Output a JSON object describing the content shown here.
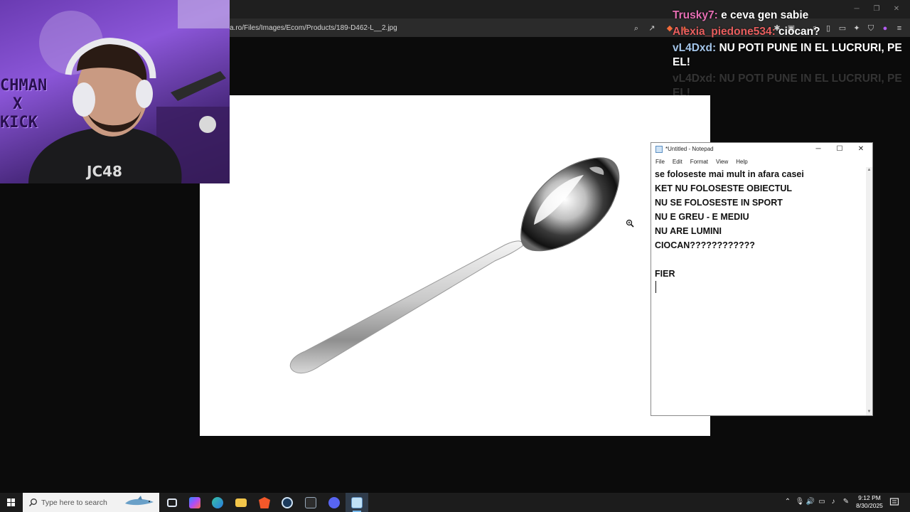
{
  "browser": {
    "url": "a.ro/Files/Images/Ecom/Products/189-D462-L__2.jpg",
    "toolbar_icons": [
      "zoom-icon",
      "share-icon",
      "brave-shield-icon",
      "brave-rewards-icon",
      "extensions-icon",
      "screenshot-icon",
      "music-icon",
      "sidebar-icon",
      "wallet-icon",
      "leo-icon",
      "vpn-icon",
      "menu-icon"
    ]
  },
  "viewer": {
    "image_subject": "spoon"
  },
  "chat": {
    "messages": [
      {
        "user": "Trusky7:",
        "text": "e ceva gen sabie",
        "color": "#e66fb4"
      },
      {
        "user": "Alexia_piedone534:",
        "text": "ciocan?",
        "color": "#e85e5e"
      },
      {
        "user": "vL4Dxd:",
        "text": "NU POTI PUNE IN EL LUCRURI, PE EL!",
        "color": "#a3c4e8"
      },
      {
        "user": "vL4Dxd:",
        "text": "NU POTI PUNE IN EL LUCRURI, PE EL!",
        "color": "#a3c4e8"
      }
    ]
  },
  "notepad": {
    "title": "*Untitled - Notepad",
    "menu": [
      "File",
      "Edit",
      "Format",
      "View",
      "Help"
    ],
    "lines": [
      "se foloseste mai mult in afara casei",
      "KET NU FOLOSESTE OBIECTUL",
      "NU SE FOLOSESTE IN SPORT",
      "NU E GREU - E MEDIU",
      "NU ARE LUMINI",
      "CIOCAN????????????",
      "",
      "FIER"
    ]
  },
  "webcam": {
    "sign_text": [
      "CHMAN",
      "X",
      "KICK"
    ]
  },
  "taskbar": {
    "search_placeholder": "Type here to search",
    "time": "9:12 PM",
    "date": "8/30/2025",
    "apps": [
      "task-view-icon",
      "copilot-icon",
      "edge-icon",
      "file-explorer-icon",
      "brave-icon",
      "steam-icon",
      "excel-icon",
      "discord-icon",
      "notepad-icon"
    ]
  }
}
